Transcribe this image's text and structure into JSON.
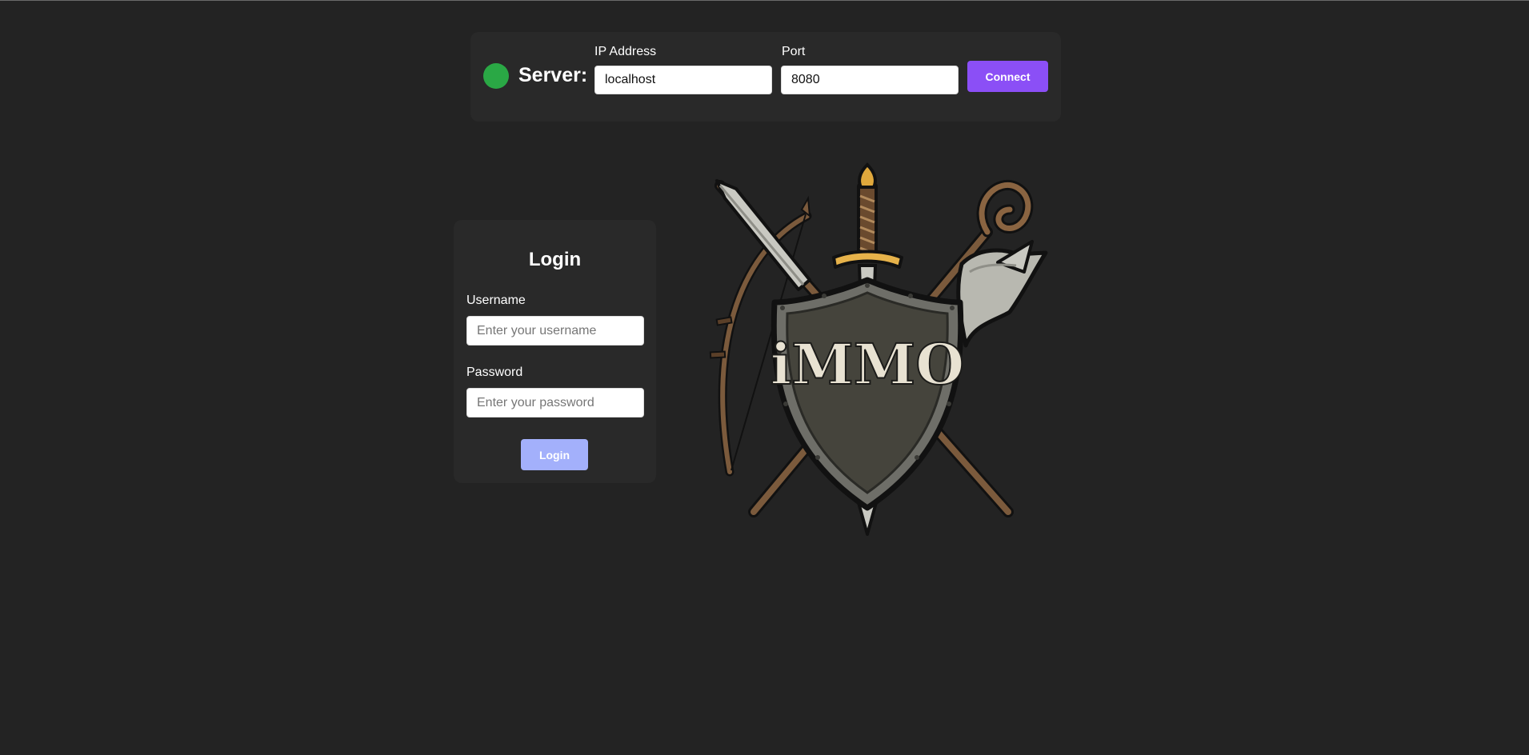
{
  "server_bar": {
    "status_color": "#2aa845",
    "label": "Server:",
    "ip": {
      "label": "IP Address",
      "value": "localhost"
    },
    "port": {
      "label": "Port",
      "value": "8080"
    },
    "connect_label": "Connect",
    "connect_color": "#8b4ff6"
  },
  "login": {
    "title": "Login",
    "username": {
      "label": "Username",
      "placeholder": "Enter your username"
    },
    "password": {
      "label": "Password",
      "placeholder": "Enter your password"
    },
    "button_label": "Login",
    "button_color": "#a3b0fb"
  },
  "emblem": {
    "text": "iMMO",
    "icon": "crossed-weapons-shield-emblem"
  },
  "colors": {
    "background": "#232323",
    "panel": "#292929"
  }
}
